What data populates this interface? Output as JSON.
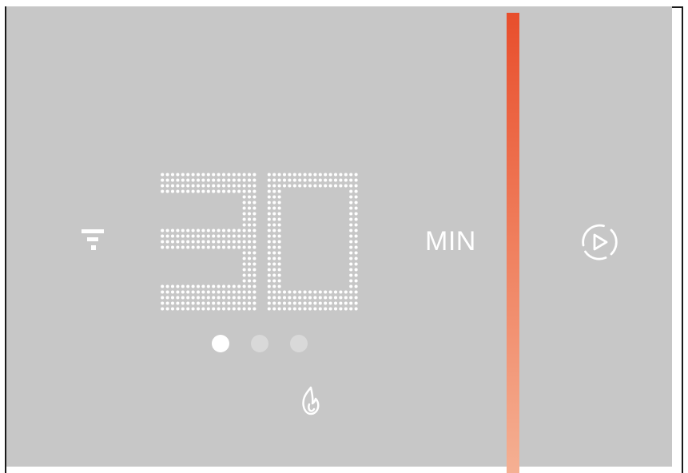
{
  "display": {
    "value": "30",
    "unit": "MIN"
  },
  "mode": {
    "icon": "comfort-settings-icon",
    "function_icon": "flame-icon"
  },
  "actions": {
    "start_icon": "play-circle-icon"
  },
  "pagination": {
    "total": 3,
    "current": 1
  },
  "colors": {
    "screen_background": "#c7c7c7",
    "foreground": "#ffffff",
    "inactive_dot": "#d9d9d9",
    "heat_bar_top": "#e84e2c",
    "heat_bar_bottom": "#f5b093"
  }
}
